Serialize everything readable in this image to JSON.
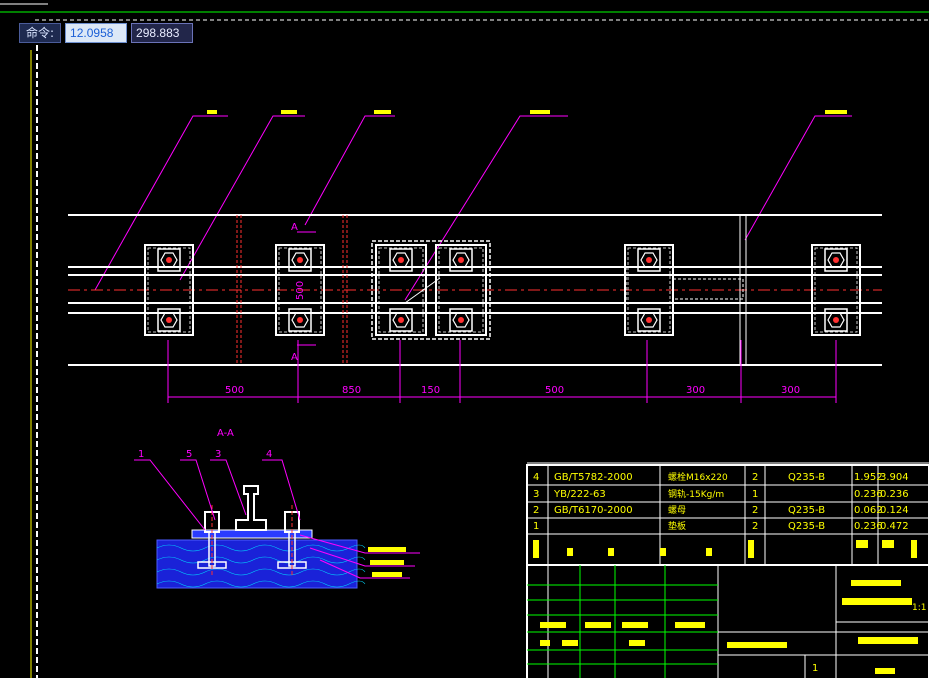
{
  "command": {
    "label": "命令:",
    "x_value": "12.0958",
    "y_value": "298.883"
  },
  "section_label": "A-A",
  "cut_marks": [
    "A",
    "A"
  ],
  "vertical_dim": "500",
  "dimensions": [
    "500",
    "850",
    "150",
    "500",
    "300",
    "300"
  ],
  "section_numbers": [
    "1",
    "5",
    "3",
    "4"
  ],
  "parts_table": {
    "rows": [
      {
        "no": "4",
        "std": "GB/T5782-2000",
        "name": "螺栓M16x220",
        "qty": "2",
        "mat": "Q235-B",
        "w1": "1.952",
        "w2": "3.904"
      },
      {
        "no": "3",
        "std": "YB/222-63",
        "name": "钢轨-15Kg/m",
        "qty": "1",
        "mat": "",
        "w1": "0.236",
        "w2": "0.236"
      },
      {
        "no": "2",
        "std": "GB/T6170-2000",
        "name": "螺母",
        "qty": "2",
        "mat": "Q235-B",
        "w1": "0.062",
        "w2": "0.124"
      },
      {
        "no": "1",
        "std": "",
        "name": "垫板",
        "qty": "2",
        "mat": "Q235-B",
        "w1": "0.236",
        "w2": "0.472"
      }
    ],
    "sheet_count": "1:1"
  },
  "colors": {
    "white": "#ffffff",
    "yellow": "#ffff00",
    "magenta": "#ff00ff",
    "red": "#ff3030",
    "green": "#00ff00",
    "blue": "#2a3cff",
    "cyan": "#00ffff"
  }
}
